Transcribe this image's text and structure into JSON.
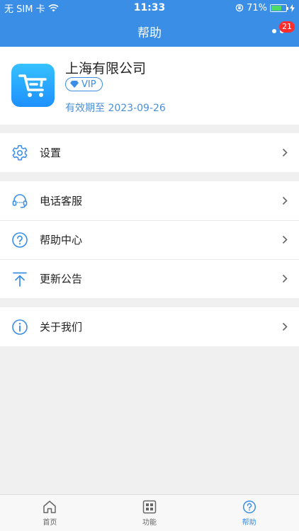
{
  "status": {
    "carrier": "无 SIM 卡",
    "time": "11:33",
    "battery_text": "71%",
    "battery_level": 0.71
  },
  "nav": {
    "title": "帮助",
    "badge": "21"
  },
  "profile": {
    "company": "上海有限公司",
    "vip": "VIP",
    "expire": "有效期至  2023-09-26"
  },
  "menu": {
    "settings": "设置",
    "phone_service": "电话客服",
    "help_center": "帮助中心",
    "updates": "更新公告",
    "about": "关于我们"
  },
  "tabs": [
    {
      "label": "首页",
      "icon": "home-icon"
    },
    {
      "label": "功能",
      "icon": "grid-icon"
    },
    {
      "label": "帮助",
      "icon": "help-icon"
    }
  ],
  "colors": {
    "accent": "#3a8ee6",
    "badge": "#ff2d2d",
    "battery": "#4cd964"
  }
}
